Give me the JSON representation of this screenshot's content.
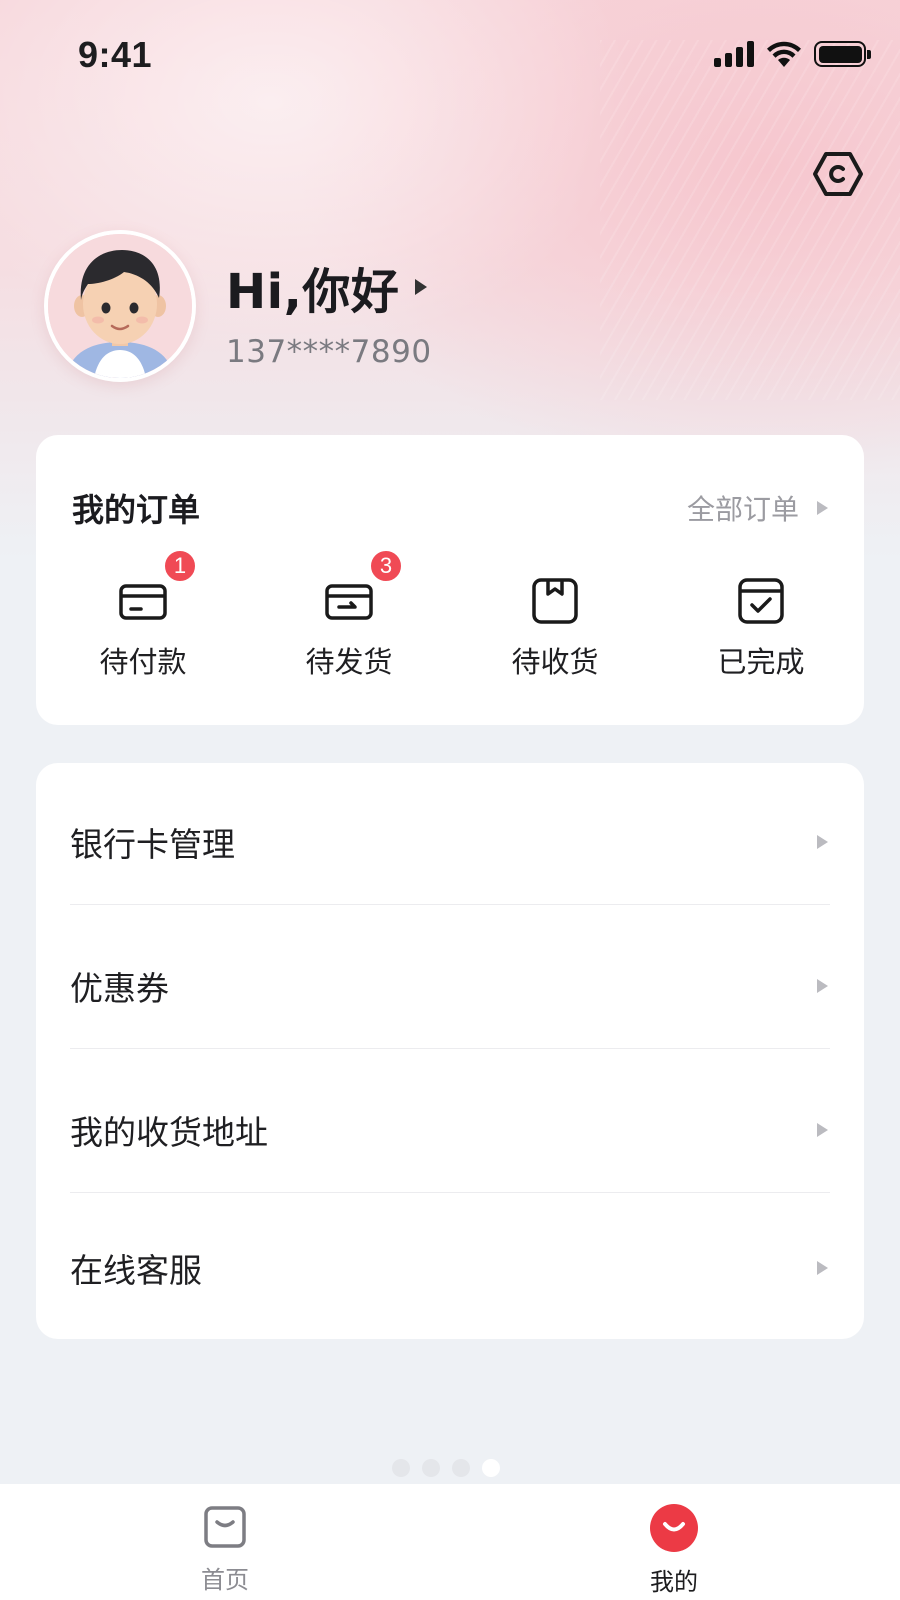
{
  "status_bar": {
    "time": "9:41"
  },
  "profile": {
    "greeting": "Hi,你好",
    "phone": "137****7890"
  },
  "orders": {
    "title": "我的订单",
    "all_label": "全部订单",
    "items": [
      {
        "label": "待付款",
        "badge": "1",
        "icon": "wallet-icon"
      },
      {
        "label": "待发货",
        "badge": "3",
        "icon": "package-send-icon"
      },
      {
        "label": "待收货",
        "badge": "",
        "icon": "box-icon"
      },
      {
        "label": "已完成",
        "badge": "",
        "icon": "check-box-icon"
      }
    ]
  },
  "menu": {
    "items": [
      {
        "label": "银行卡管理"
      },
      {
        "label": "优惠券"
      },
      {
        "label": "我的收货地址"
      },
      {
        "label": "在线客服"
      }
    ]
  },
  "pager": {
    "count": 4,
    "active_index": 3
  },
  "tab_bar": {
    "items": [
      {
        "label": "首页",
        "icon": "shopping-bag-icon",
        "active": false
      },
      {
        "label": "我的",
        "icon": "smile-icon",
        "active": true
      }
    ]
  },
  "colors": {
    "accent": "#ec3a45",
    "badge": "#f04a55",
    "background": "#eef1f5"
  }
}
